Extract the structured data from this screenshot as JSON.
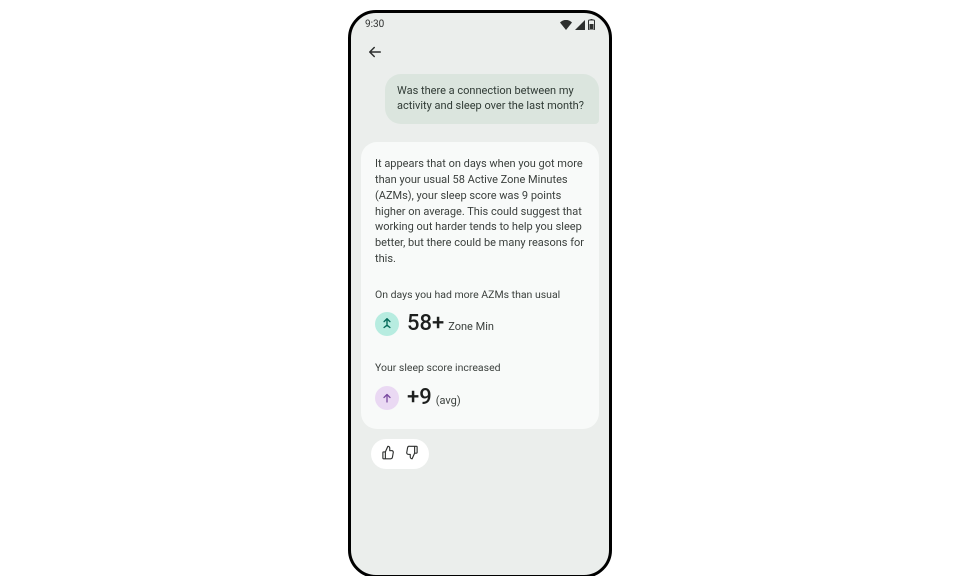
{
  "status": {
    "time": "9:30"
  },
  "messages": {
    "user": "Was there a connection between my activity and sleep over the last month?",
    "assistant": "It appears that on days when you got more than your usual 58 Active Zone Minutes (AZMs), your sleep score was 9 points higher on average. This could suggest that working out harder tends to help you sleep better, but there could be many reasons for this."
  },
  "insights": {
    "azm": {
      "label": "On days you had more AZMs than usual",
      "value": "58+",
      "unit": "Zone Min"
    },
    "sleep": {
      "label": "Your sleep score increased",
      "value": "+9",
      "unit": "(avg)"
    }
  }
}
